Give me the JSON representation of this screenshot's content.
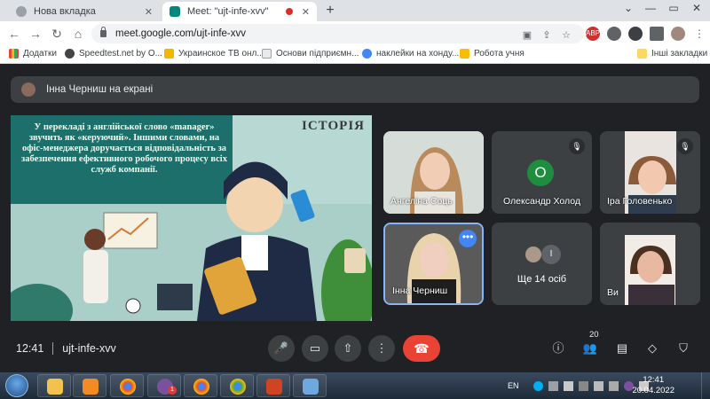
{
  "browser": {
    "tabs": [
      {
        "label": "Нова вкладка",
        "close": "✕"
      },
      {
        "label": "Meet: \"ujt-infe-xvv\"",
        "close": "✕"
      }
    ],
    "new_tab": "+",
    "url": "meet.google.com/ujt-infe-xvv",
    "extensions": [
      "ABP"
    ],
    "bookmarks": [
      "Додатки",
      "Speedtest.net by O...",
      "Украинское ТВ онл...",
      "Основи підприємн...",
      "наклейки на хонду...",
      "Робота учня"
    ],
    "other_bookmarks": "Інші закладки"
  },
  "meet": {
    "presenting_label": "Інна Черниш на екрані",
    "slide": {
      "title": "ІСТОРІЯ",
      "text": "У перекладі з англійської слово «manager» звучить як «керуючий». Іншими словами, на офіс-менеджера доручається відповідальність за забезпечення ефективного робочого процесу всіх служб компанії."
    },
    "participants": [
      {
        "name": "Ангеліна Соць",
        "muted": false
      },
      {
        "name": "Олександр Холод",
        "initial": "О",
        "muted": true
      },
      {
        "name": "Іра Головенько",
        "muted": true
      },
      {
        "name": "Інна Черниш",
        "active": true,
        "more_icon": "•••"
      },
      {
        "name": "Ще 14 осіб",
        "avatar_initial": "І"
      },
      {
        "name": "Ви"
      }
    ],
    "time": "12:41",
    "meeting_code": "ujt-infe-xvv",
    "people_count": "20",
    "colors": {
      "hangup": "#ea4335",
      "active_border": "#8ab4f8",
      "avatar_green": "#1e8e3e"
    }
  },
  "taskbar": {
    "lang": "EN",
    "time": "12:41",
    "date": "20.04.2022",
    "badge": "1"
  }
}
